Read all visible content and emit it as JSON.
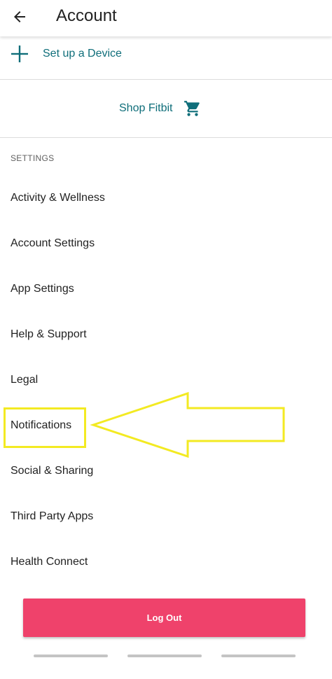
{
  "appbar": {
    "title": "Account",
    "back_icon": "arrow-left-icon"
  },
  "setup": {
    "label": "Set up a Device",
    "icon": "plus-icon"
  },
  "shop": {
    "label": "Shop Fitbit",
    "icon": "shopping-cart-icon"
  },
  "settings": {
    "header": "SETTINGS",
    "items": [
      {
        "label": "Activity & Wellness"
      },
      {
        "label": "Account Settings"
      },
      {
        "label": "App Settings"
      },
      {
        "label": "Help & Support"
      },
      {
        "label": "Legal"
      },
      {
        "label": "Notifications"
      },
      {
        "label": "Social & Sharing"
      },
      {
        "label": "Third Party Apps"
      },
      {
        "label": "Health Connect"
      }
    ]
  },
  "logout": {
    "label": "Log Out"
  },
  "colors": {
    "accent_teal": "#0f6e7a",
    "logout_pink": "#ef426b",
    "highlight_yellow": "#f3ea22"
  }
}
